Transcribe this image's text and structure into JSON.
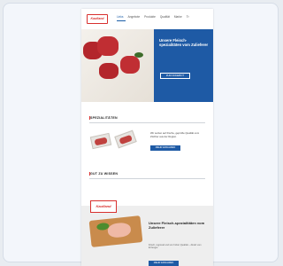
{
  "brand": {
    "logo_text": "Kaufland",
    "color": "#d8302e"
  },
  "nav": {
    "items": [
      "Links",
      "Angebote",
      "Produkte",
      "Qualität",
      "Marke",
      "Tr"
    ]
  },
  "hero": {
    "title": "Unsere Fleisch-spezialitäten vom Zulieferer",
    "button": "ZUM ANGEBOT",
    "bg_color": "#1e5aa5"
  },
  "section1": {
    "title": "SPEZIALITÄTEN",
    "text": "Wir setzen auf frische, geprüfte Qualität vom Züchter aus der Region.",
    "button": "MEHR ERFAHREN"
  },
  "section2": {
    "title": "GUT ZU WISSEN"
  },
  "bottom": {
    "logo_text": "Kaufland",
    "title": "Unsere Fleisch-spezialitäten vom Zulieferer",
    "text": "Frisch, regional und von hoher Qualität – direkt vom Erzeuger.",
    "button": "MEHR ERFAHREN"
  }
}
